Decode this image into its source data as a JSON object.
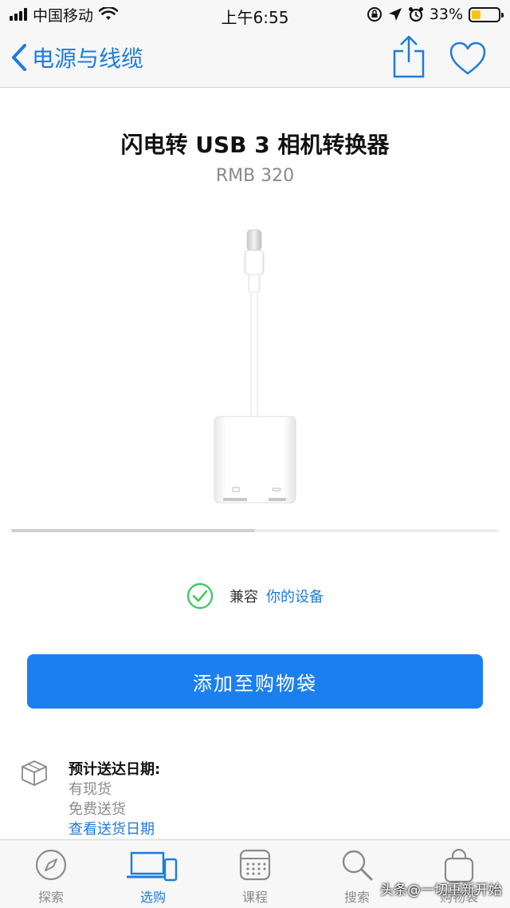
{
  "status_bar": {
    "carrier": "中国移动",
    "time": "上午6:55",
    "battery_percent": "33%",
    "battery_level": 0.33,
    "signal_icon": "signal-icon",
    "wifi_icon": "wifi-icon",
    "orientation_lock_icon": "orientation-lock-icon",
    "location_icon": "location-icon",
    "alarm_icon": "alarm-icon"
  },
  "nav": {
    "back_label": "电源与线缆",
    "back_icon": "chevron-left-icon",
    "share_icon": "share-icon",
    "favorite_icon": "heart-icon"
  },
  "product": {
    "title": "闪电转 USB 3 相机转换器",
    "price": "RMB 320",
    "image_icon": "lightning-usb-adapter-image",
    "gallery_progress": 0.5
  },
  "compatibility": {
    "label": "兼容",
    "link": "你的设备",
    "icon": "check-circle-icon"
  },
  "cta": {
    "add_to_bag": "添加至购物袋"
  },
  "delivery": {
    "title": "预计送达日期:",
    "stock": "有现货",
    "shipping": "免费送货",
    "link": "查看送货日期",
    "icon": "box-icon"
  },
  "tab_bar": {
    "tabs": [
      {
        "label": "探索",
        "icon": "compass-icon",
        "active": false
      },
      {
        "label": "选购",
        "icon": "devices-icon",
        "active": true
      },
      {
        "label": "课程",
        "icon": "calendar-icon",
        "active": false
      },
      {
        "label": "搜索",
        "icon": "search-icon",
        "active": false
      },
      {
        "label": "购物袋",
        "icon": "bag-icon",
        "active": false
      }
    ]
  },
  "watermark": "头条@一切重新开始",
  "colors": {
    "accent": "#1c7cdd",
    "button": "#1c7ff0",
    "check_green": "#34c759",
    "battery": "#f5c518"
  }
}
